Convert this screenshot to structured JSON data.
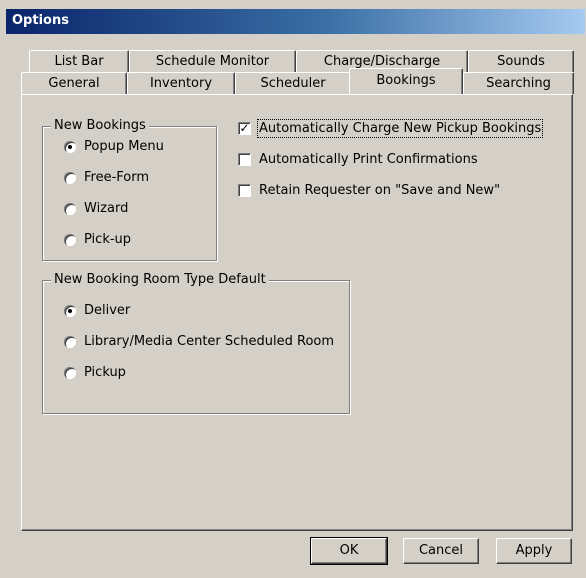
{
  "window": {
    "title": "Options"
  },
  "tabs_row_back": [
    {
      "label": "List Bar"
    },
    {
      "label": "Schedule Monitor"
    },
    {
      "label": "Charge/Discharge"
    },
    {
      "label": "Sounds"
    }
  ],
  "tabs_row_front": [
    {
      "label": "General"
    },
    {
      "label": "Inventory"
    },
    {
      "label": "Scheduler"
    },
    {
      "label": "Bookings",
      "active": true
    },
    {
      "label": "Searching"
    }
  ],
  "new_bookings": {
    "legend": "New Bookings",
    "options": [
      {
        "label": "Popup Menu",
        "checked": true
      },
      {
        "label": "Free-Form",
        "checked": false
      },
      {
        "label": "Wizard",
        "checked": false
      },
      {
        "label": "Pick-up",
        "checked": false
      }
    ]
  },
  "room_type_default": {
    "legend": "New Booking Room Type Default",
    "options": [
      {
        "label": "Deliver",
        "checked": true
      },
      {
        "label": "Library/Media Center Scheduled Room",
        "checked": false
      },
      {
        "label": "Pickup",
        "checked": false
      }
    ]
  },
  "checkboxes": [
    {
      "label": "Automatically Charge New Pickup Bookings",
      "checked": true
    },
    {
      "label": "Automatically Print Confirmations",
      "checked": false
    },
    {
      "label": "Retain Requester on \"Save and New\"",
      "checked": false
    }
  ],
  "buttons": {
    "ok": "OK",
    "cancel": "Cancel",
    "apply": "Apply"
  }
}
